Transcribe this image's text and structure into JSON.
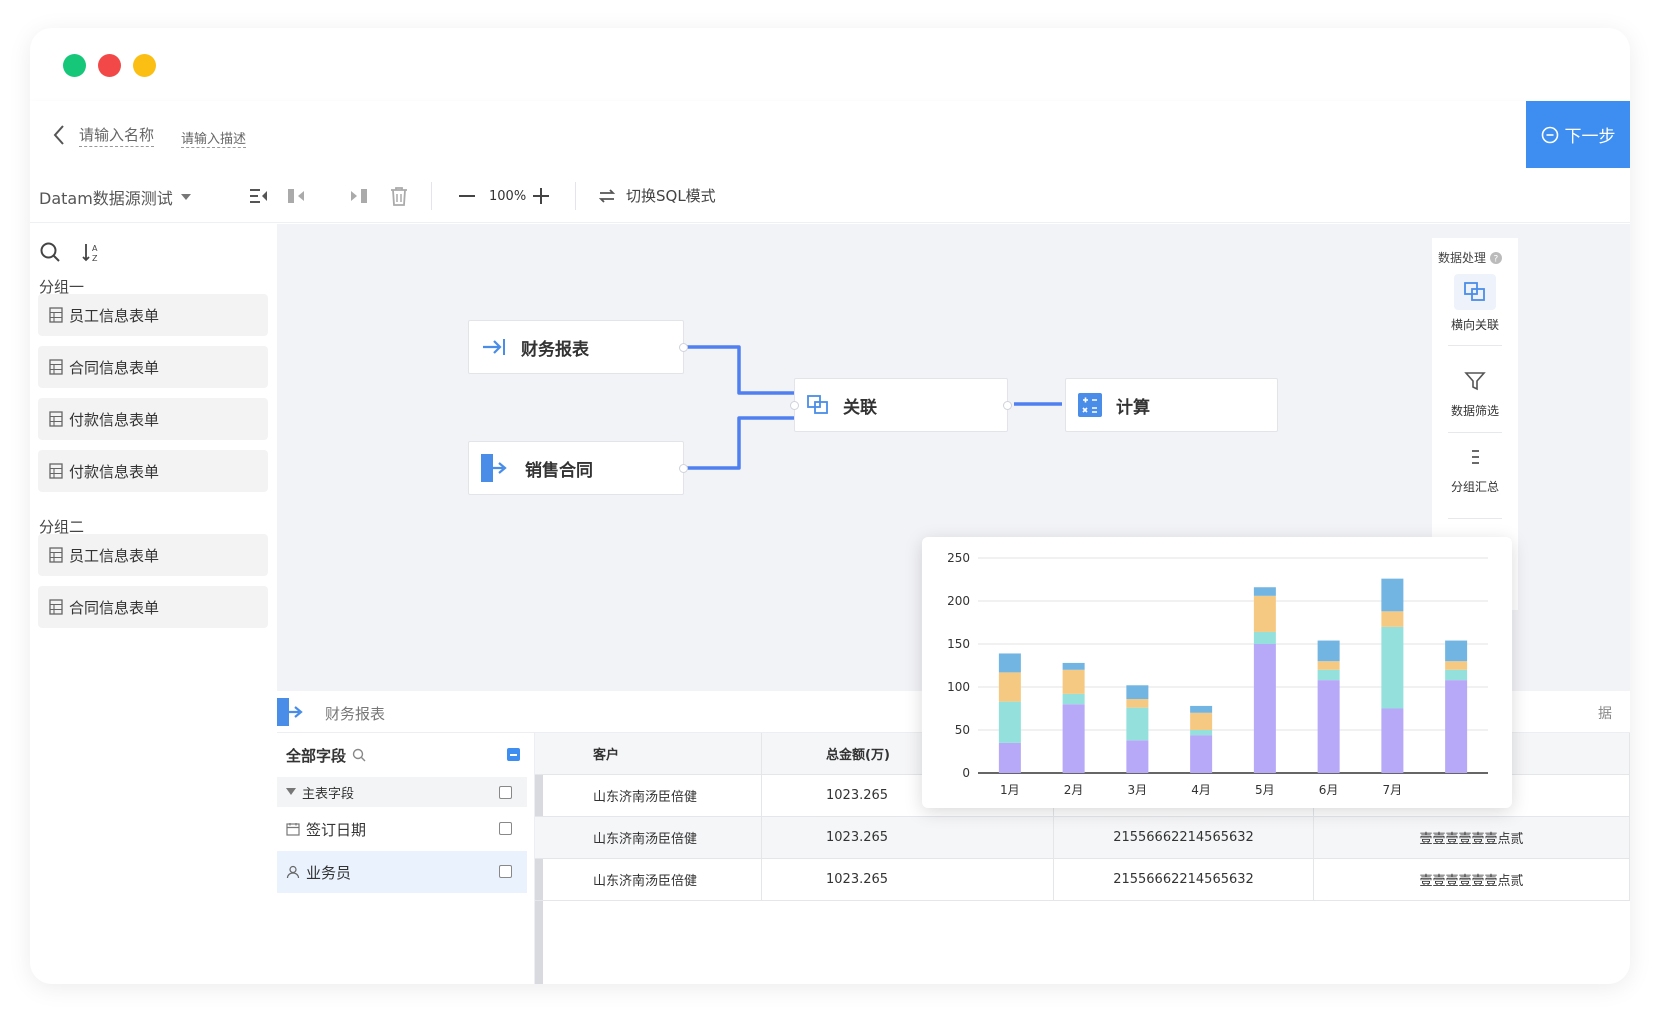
{
  "header": {
    "name_placeholder": "请输入名称",
    "desc_placeholder": "请输入描述",
    "next_label": "下一步"
  },
  "toolbar": {
    "datasource": "Datam数据源测试",
    "zoom": "100%",
    "sql_mode_label": "切换SQL模式"
  },
  "sidebar": {
    "groups": [
      {
        "label": "分组一",
        "items": [
          "员工信息表单",
          "合同信息表单",
          "付款信息表单",
          "付款信息表单"
        ]
      },
      {
        "label": "分组二",
        "items": [
          "员工信息表单",
          "合同信息表单"
        ]
      }
    ]
  },
  "canvas": {
    "nodes": {
      "finance": "财务报表",
      "sales": "销售合同",
      "join": "关联",
      "calc": "计算"
    }
  },
  "right_panel": {
    "title": "数据处理",
    "items": [
      "横向关联",
      "数据筛选",
      "分组汇总"
    ]
  },
  "bottom": {
    "source_label": "财务报表",
    "field_panel": {
      "title": "全部字段",
      "group_label": "主表字段",
      "fields": [
        "签订日期",
        "业务员"
      ]
    },
    "table": {
      "headers": [
        "客户",
        "总金额(万)",
        "",
        ""
      ],
      "rows": [
        [
          "山东济南汤臣倍健",
          "1023.265",
          "",
          ""
        ],
        [
          "山东济南汤臣倍健",
          "1023.265",
          "21556662214565632",
          "壹壹壹壹壹壹点贰"
        ],
        [
          "山东济南汤臣倍健",
          "1023.265",
          "21556662214565632",
          "壹壹壹壹壹壹点贰"
        ]
      ],
      "edge_text": "据"
    }
  },
  "colors": {
    "accent": "#3d8ef0",
    "edge": "#4f7ff0",
    "canvas_bg": "#f2f3f7"
  },
  "chart_data": {
    "type": "bar",
    "stacked": true,
    "categories": [
      "1月",
      "2月",
      "3月",
      "4月",
      "5月",
      "6月",
      "7月",
      ""
    ],
    "ylim": [
      0,
      250
    ],
    "yticks": [
      0,
      50,
      100,
      150,
      200,
      250
    ],
    "series": [
      {
        "color": "#b8a9f8",
        "values": [
          35,
          80,
          38,
          44,
          150,
          108,
          75,
          108
        ]
      },
      {
        "color": "#94e0dc",
        "values": [
          48,
          12,
          38,
          6,
          14,
          12,
          95,
          12
        ]
      },
      {
        "color": "#f6c982",
        "values": [
          34,
          28,
          10,
          20,
          42,
          10,
          18,
          10
        ]
      },
      {
        "color": "#72b5e2",
        "values": [
          22,
          8,
          16,
          8,
          10,
          24,
          38,
          24
        ]
      }
    ]
  }
}
